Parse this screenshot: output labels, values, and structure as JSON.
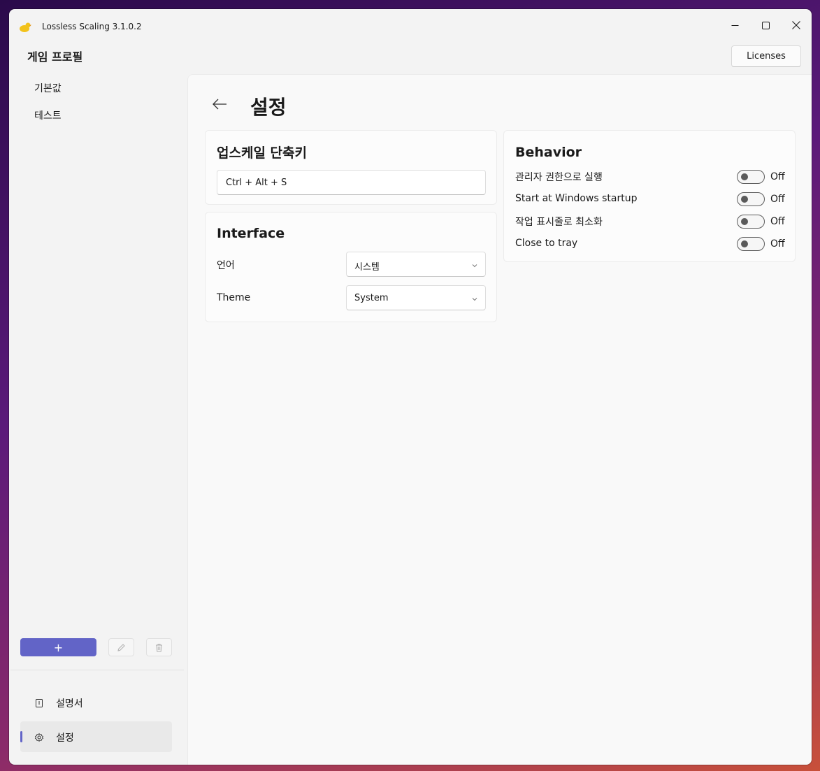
{
  "app": {
    "title": "Lossless Scaling 3.1.0.2"
  },
  "sidebar": {
    "title": "게임 프로필",
    "profiles": [
      "기본값",
      "테스트"
    ],
    "add_label": "+",
    "nav": [
      {
        "label": "설명서",
        "icon": "book-icon",
        "active": false
      },
      {
        "label": "설정",
        "icon": "gear-icon",
        "active": true
      }
    ]
  },
  "header": {
    "licenses_label": "Licenses"
  },
  "settings": {
    "page_title": "설정",
    "hotkey": {
      "title": "업스케일 단축키",
      "value": "Ctrl + Alt + S"
    },
    "interface": {
      "title": "Interface",
      "language_label": "언어",
      "language_value": "시스템",
      "theme_label": "Theme",
      "theme_value": "System"
    },
    "behavior": {
      "title": "Behavior",
      "toggles": [
        {
          "label": "관리자 권한으로 실행",
          "state": "Off"
        },
        {
          "label": "Start at Windows startup",
          "state": "Off"
        },
        {
          "label": "작업 표시줄로 최소화",
          "state": "Off"
        },
        {
          "label": "Close to tray",
          "state": "Off"
        }
      ]
    }
  },
  "colors": {
    "accent": "#6264c7"
  }
}
